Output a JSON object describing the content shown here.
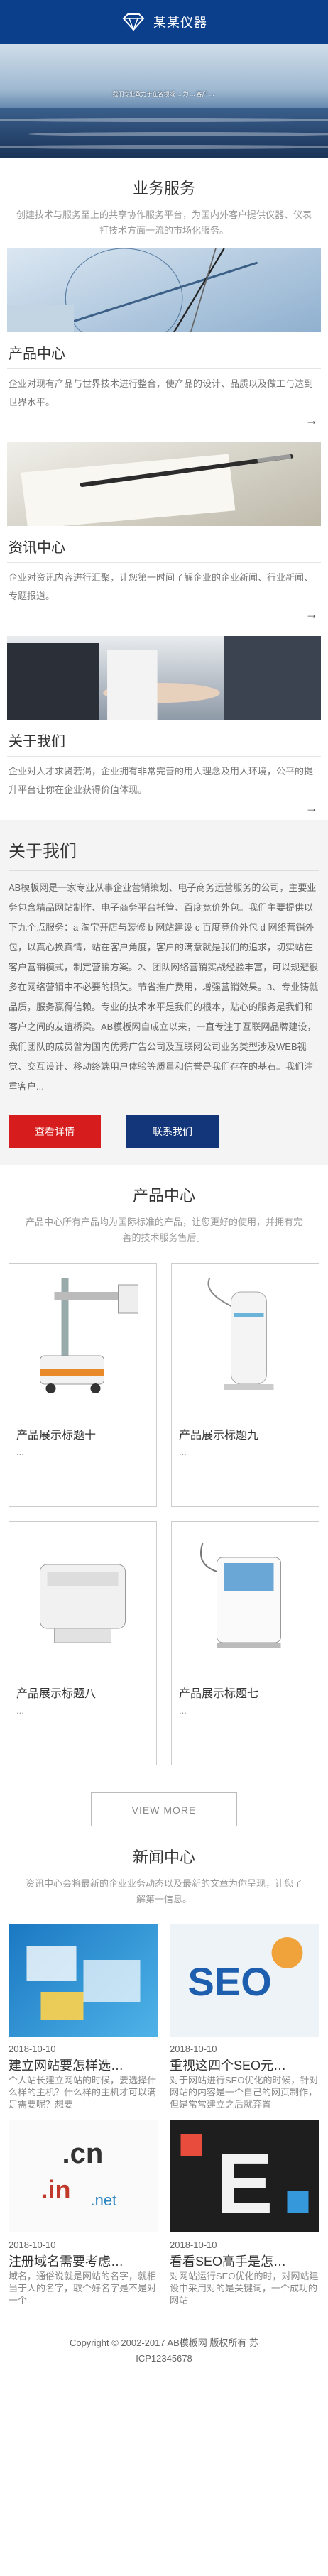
{
  "header": {
    "brand": "某某仪器"
  },
  "banner": {
    "caption": "我们专业致力于在各领域 ... 为 ... 客户 ..."
  },
  "business": {
    "title": "业务服务",
    "desc": "创建技术与服务至上的共享协作服务平台，为国内外客户提供仪器、仪表打技术方面一流的市场化服务。",
    "items": [
      {
        "title": "产品中心",
        "desc": "企业对现有产品与世界技术进行整合，使产品的设计、品质以及做工与达到世界水平。",
        "arrow": "→"
      },
      {
        "title": "资讯中心",
        "desc": "企业对资讯内容进行汇聚，让您第一时间了解企业的企业新闻、行业新闻、专题报道。",
        "arrow": "→"
      },
      {
        "title": "关于我们",
        "desc": "企业对人才求贤若渴，企业拥有非常完善的用人理念及用人环境，公平的提升平台让你在企业获得价值体现。",
        "arrow": "→"
      }
    ]
  },
  "about": {
    "title": "关于我们",
    "text": "AB模板网是一家专业从事企业营销策划、电子商务运营服务的公司，主要业务包含精品网站制作、电子商务平台托管、百度竞价外包。我们主要提供以下九个点服务：a 淘宝开店与装修 b 网站建设 c 百度竞价外包 d 网络营销外包，以真心换真情，站在客户角度，客户的满意就是我们的追求，切实站在客户营销模式，制定营销方案。2、团队网络营销实战经验丰富，可以规避很多在网络营销中不必要的损失。节省推广费用，增强营销效果。3、专业铸就品质，服务赢得信赖。专业的技术水平是我们的根本，贴心的服务是我们和客户之间的友谊桥梁。AB模板网自成立以来，一直专注于互联网品牌建设，我们团队的成员曾为国内优秀广告公司及互联网公司业务类型涉及WEB视觉、交互设计、移动终端用户体验等质量和信誉是我们存在的基石。我们注重客户...",
    "btn_detail": "查看详情",
    "btn_contact": "联系我们"
  },
  "products": {
    "title": "产品中心",
    "desc": "产品中心所有产品均为国际标准的产品，让您更好的使用，并拥有完善的技术服务售后。",
    "items": [
      {
        "name": "产品展示标题十",
        "dots": "..."
      },
      {
        "name": "产品展示标题九",
        "dots": "..."
      },
      {
        "name": "产品展示标题八",
        "dots": "..."
      },
      {
        "name": "产品展示标题七",
        "dots": "..."
      }
    ],
    "more": "VIEW MORE"
  },
  "news": {
    "title": "新闻中心",
    "desc": "资讯中心会将最新的企业业务动态以及最新的文章为你呈现，让您了解第一信息。",
    "items": [
      {
        "date": "2018-10-10",
        "title": "建立网站要怎样选…",
        "desc": "个人站长建立网站的时候，要选择什么样的主机？什么样的主机才可以满足需要呢？想要"
      },
      {
        "date": "2018-10-10",
        "title": "重视这四个SEO元…",
        "desc": "对于网站进行SEO优化的时候，针对网站的内容是一个自己的网页制作，但是常常建立之后就弃置"
      },
      {
        "date": "2018-10-10",
        "title": "注册域名需要考虑…",
        "desc": "域名，通俗说就是网站的名字，就相当于人的名字，取个好名字是不是对一个"
      },
      {
        "date": "2018-10-10",
        "title": "看看SEO高手是怎…",
        "desc": "对网站运行SEO优化的时，对网站建设中采用对的是关键词，一个成功的网站"
      }
    ]
  },
  "footer": {
    "line1": "Copyright © 2002-2017 AB模板网 版权所有  苏",
    "line2": "ICP12345678"
  },
  "colors": {
    "header": "#0b3f8c",
    "red_button": "#d61c1c",
    "blue_button": "#13357a"
  }
}
